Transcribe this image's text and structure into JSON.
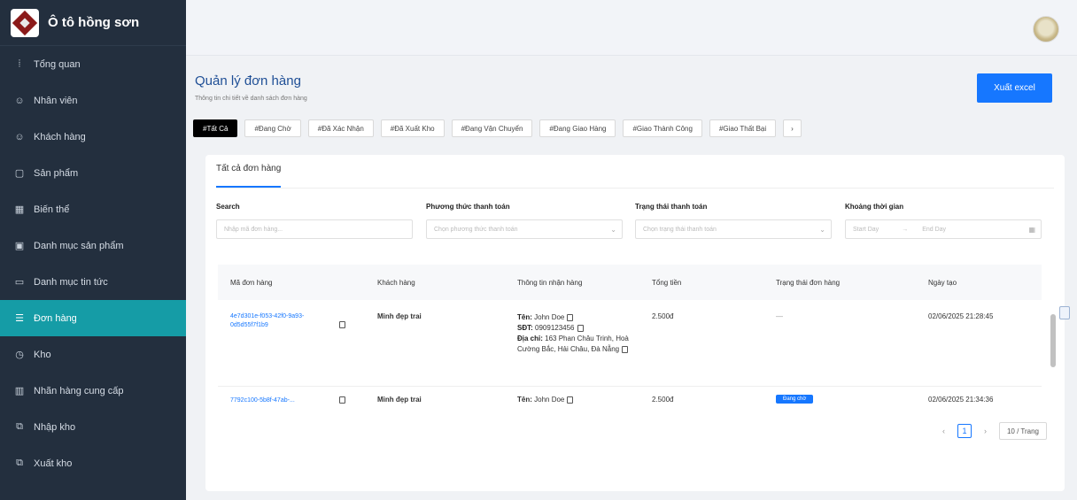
{
  "brand": {
    "name": "Ô tô hồng sơn"
  },
  "sidebar": {
    "items": [
      {
        "label": "Tổng quan",
        "icon": "chart-icon"
      },
      {
        "label": "Nhân viên",
        "icon": "user-icon"
      },
      {
        "label": "Khách hàng",
        "icon": "user-icon"
      },
      {
        "label": "Sản phẩm",
        "icon": "box-icon"
      },
      {
        "label": "Biến thể",
        "icon": "grid-icon"
      },
      {
        "label": "Danh mục sản phẩm",
        "icon": "folder-icon"
      },
      {
        "label": "Danh mục tin tức",
        "icon": "folder-icon"
      },
      {
        "label": "Đơn hàng",
        "icon": "list-icon",
        "active": true
      },
      {
        "label": "Kho",
        "icon": "clock-icon"
      },
      {
        "label": "Nhãn hàng cung cấp",
        "icon": "tag-icon"
      },
      {
        "label": "Nhập kho",
        "icon": "import-icon"
      },
      {
        "label": "Xuất kho",
        "icon": "export-icon"
      }
    ]
  },
  "header": {
    "title": "Quản lý đơn hàng",
    "subtitle": "Thông tin chi tiết về danh sách đơn hàng",
    "export_label": "Xuất excel"
  },
  "filters": [
    "#Tất Cả",
    "#Đang Chờ",
    "#Đã Xác Nhận",
    "#Đã Xuất Kho",
    "#Đang Vận Chuyển",
    "#Đang Giao Hàng",
    "#Giao Thành Công",
    "#Giao Thất Bại",
    "›"
  ],
  "tab": {
    "label": "Tất cả đơn hàng"
  },
  "search_filters": {
    "search_label": "Search",
    "search_placeholder": "Nhập mã đơn hàng...",
    "payment_method_label": "Phương thức thanh toán",
    "payment_method_placeholder": "Chọn phương thức thanh toán",
    "payment_status_label": "Trạng thái thanh toán",
    "payment_status_placeholder": "Chọn trạng thái thanh toán",
    "date_range_label": "Khoảng thời gian",
    "start_placeholder": "Start Day",
    "end_placeholder": "End Day",
    "range_arrow": "→"
  },
  "table": {
    "columns": [
      "Mã đơn hàng",
      "Khách hàng",
      "Thông tin nhận hàng",
      "Tổng tiền",
      "Trạng thái đơn hàng",
      "Ngày tạo"
    ],
    "rows": [
      {
        "order_id": "4e7d301e-f053-42f0-9a93-0d5d55f7f1b9",
        "customer": "Minh đẹp trai",
        "recipient_name_label": "Tên:",
        "recipient_name": "John Doe",
        "phone_label": "SĐT:",
        "phone": "0909123456",
        "address_label": "Địa chỉ:",
        "address": "163 Phan Châu Trinh, Hoà Cường Bắc, Hải Châu, Đà Nẵng",
        "total": "2.500đ",
        "status": "—",
        "created": "02/06/2025 21:28:45"
      },
      {
        "order_id": "7792c100-5b8f-47ab-...",
        "customer": "Minh đẹp trai",
        "recipient_name_label": "Tên:",
        "recipient_name": "John Doe",
        "total": "2.500đ",
        "status": "Đang chờ",
        "created": "02/06/2025 21:34:36"
      }
    ]
  },
  "pagination": {
    "prev": "‹",
    "current": "1",
    "next": "›",
    "page_size": "10 / Trang"
  },
  "colors": {
    "sidebar_bg": "#232f3e",
    "active_item": "#159ca6",
    "accent": "#1677ff"
  }
}
